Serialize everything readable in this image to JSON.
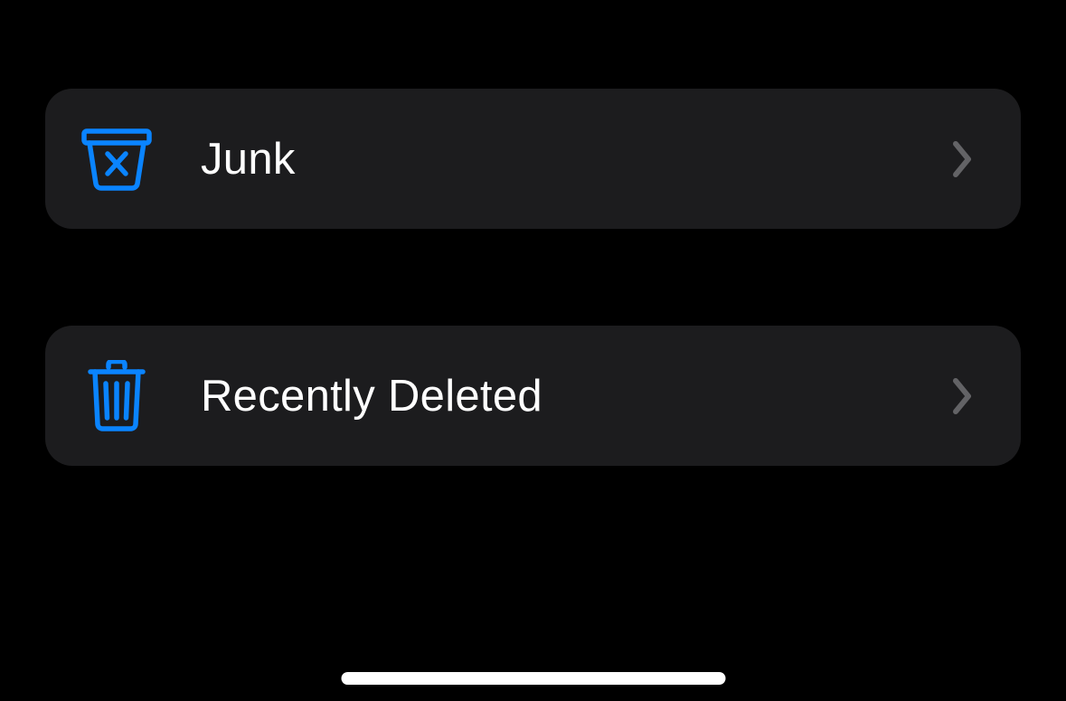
{
  "colors": {
    "accent": "#0a84ff",
    "chevron": "#636366",
    "rowBackground": "#1c1c1e",
    "text": "#ffffff"
  },
  "rows": [
    {
      "id": "junk",
      "icon": "junk-basket-icon",
      "label": "Junk"
    },
    {
      "id": "recently-deleted",
      "icon": "trash-icon",
      "label": "Recently Deleted"
    }
  ]
}
